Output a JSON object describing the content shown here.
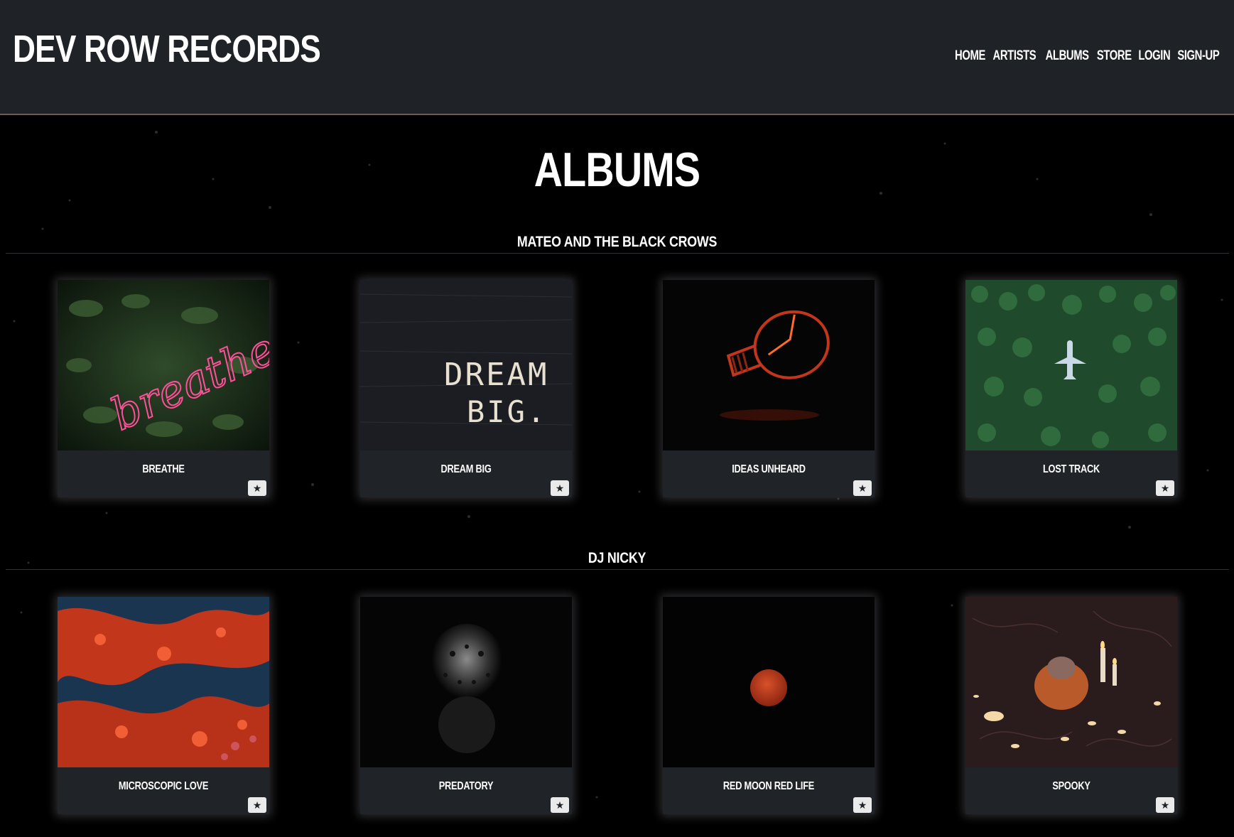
{
  "header": {
    "brand": "DEV ROW RECORDS",
    "nav": [
      {
        "label": "HOME"
      },
      {
        "label": "ARTISTS"
      },
      {
        "label": "ALBUMS"
      },
      {
        "label": "STORE"
      },
      {
        "label": "LOGIN"
      },
      {
        "label": "SIGN-UP"
      }
    ]
  },
  "main": {
    "title": "ALBUMS",
    "sections": [
      {
        "artist": "MATEO AND THE BLACK CROWS",
        "albums": [
          {
            "title": "BREATHE",
            "favorite_icon": "star-icon"
          },
          {
            "title": "DREAM BIG",
            "favorite_icon": "star-icon"
          },
          {
            "title": "IDEAS UNHEARD",
            "favorite_icon": "star-icon"
          },
          {
            "title": "LOST TRACK",
            "favorite_icon": "star-icon"
          }
        ]
      },
      {
        "artist": "DJ NICKY",
        "albums": [
          {
            "title": "MICROSCOPIC LOVE",
            "favorite_icon": "star-icon"
          },
          {
            "title": "PREDATORY",
            "favorite_icon": "star-icon"
          },
          {
            "title": "RED MOON RED LIFE",
            "favorite_icon": "star-icon"
          },
          {
            "title": "SPOOKY",
            "favorite_icon": "star-icon"
          }
        ]
      }
    ]
  },
  "cover_art_text": {
    "breathe": "breathe",
    "dream_big_line1": "DREAM",
    "dream_big_line2": "BIG."
  },
  "colors": {
    "header_bg": "#1f2227",
    "page_bg": "#000000",
    "card_bg": "#202328",
    "accent_border": "#6e5c56"
  }
}
